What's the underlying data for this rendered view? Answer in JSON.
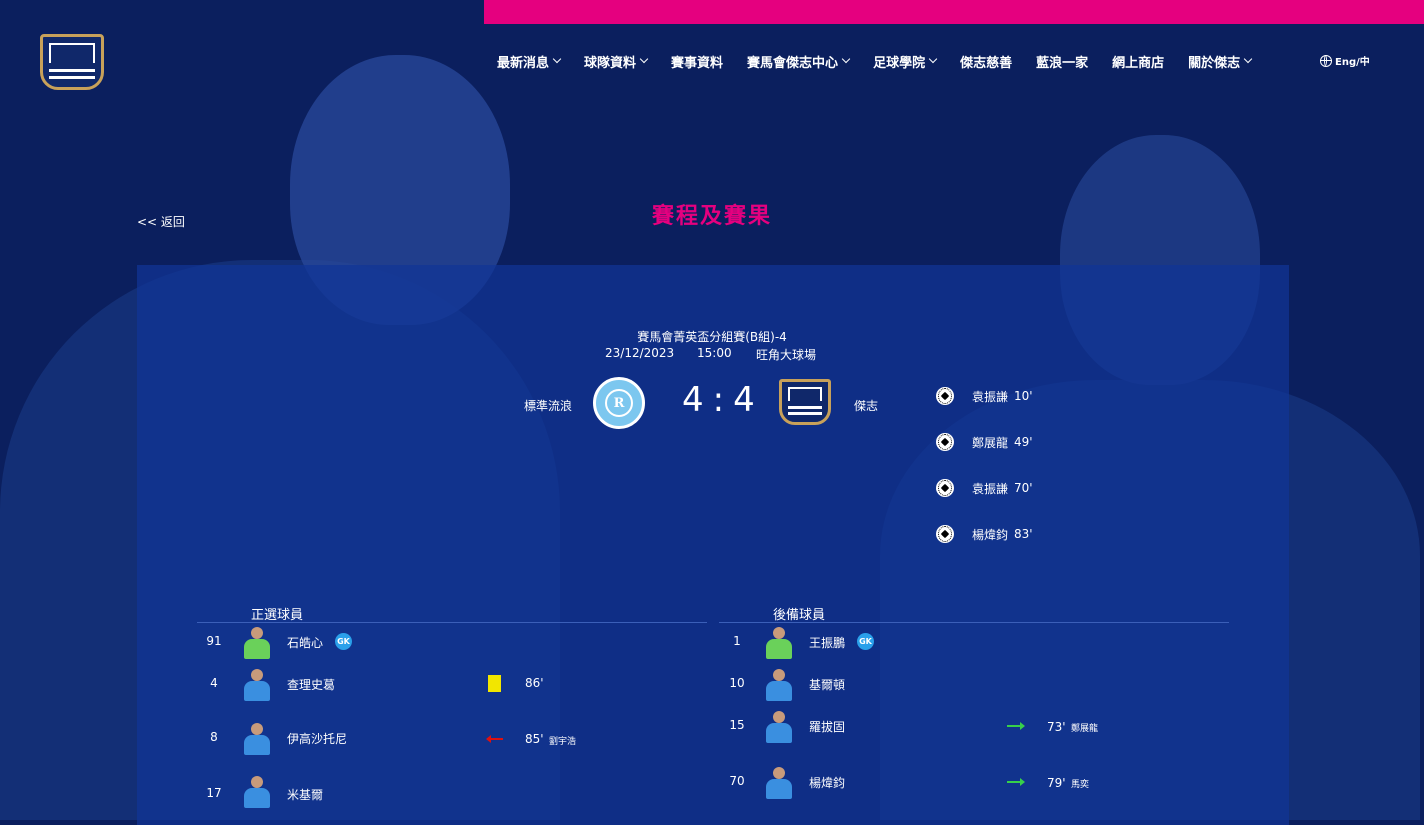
{
  "nav": {
    "items": [
      {
        "label": "最新消息",
        "dropdown": true
      },
      {
        "label": "球隊資料",
        "dropdown": true
      },
      {
        "label": "賽事資料",
        "dropdown": false
      },
      {
        "label": "賽馬會傑志中心",
        "dropdown": true
      },
      {
        "label": "足球學院",
        "dropdown": true
      },
      {
        "label": "傑志慈善",
        "dropdown": false
      },
      {
        "label": "藍浪一家",
        "dropdown": false
      },
      {
        "label": "網上商店",
        "dropdown": false
      },
      {
        "label": "關於傑志",
        "dropdown": true
      }
    ],
    "language": "Eng/中"
  },
  "back_label": "<< 返回",
  "page_title": "賽程及賽果",
  "match": {
    "competition": "賽馬會菁英盃分組賽(B組)-4",
    "date": "23/12/2023",
    "time": "15:00",
    "venue": "旺角大球場",
    "home_team": "標準流浪",
    "away_team": "傑志",
    "home_score": "4",
    "away_score": "4",
    "home_crest_letter": "R"
  },
  "goals": [
    {
      "player": "袁振謙",
      "minute": "10'"
    },
    {
      "player": "鄭展龍",
      "minute": "49'"
    },
    {
      "player": "袁振謙",
      "minute": "70'"
    },
    {
      "player": "楊煒鈞",
      "minute": "83'"
    }
  ],
  "starters": {
    "header": "正選球員",
    "players": [
      {
        "number": "91",
        "name": "石皓心",
        "gk": "GK",
        "event_minute": "",
        "event_player": ""
      },
      {
        "number": "4",
        "name": "查理史葛",
        "gk": "",
        "event_minute": "86'",
        "event_player": ""
      },
      {
        "number": "8",
        "name": "伊高沙托尼",
        "gk": "",
        "event_minute": "85'",
        "event_player": "劉宇浩"
      },
      {
        "number": "17",
        "name": "米基爾",
        "gk": "",
        "event_minute": "",
        "event_player": ""
      }
    ]
  },
  "subs": {
    "header": "後備球員",
    "players": [
      {
        "number": "1",
        "name": "王振鵬",
        "gk": "GK",
        "event_minute": "",
        "event_player": ""
      },
      {
        "number": "10",
        "name": "基爾頓",
        "gk": "",
        "event_minute": "",
        "event_player": ""
      },
      {
        "number": "15",
        "name": "羅拔固",
        "gk": "",
        "event_minute": "73'",
        "event_player": "鄭展龍"
      },
      {
        "number": "70",
        "name": "楊煒鈞",
        "gk": "",
        "event_minute": "79'",
        "event_player": "馬奕"
      }
    ]
  },
  "colors": {
    "accent": "#e5007f",
    "background": "#0b1f5e",
    "panel": "#10349699"
  }
}
